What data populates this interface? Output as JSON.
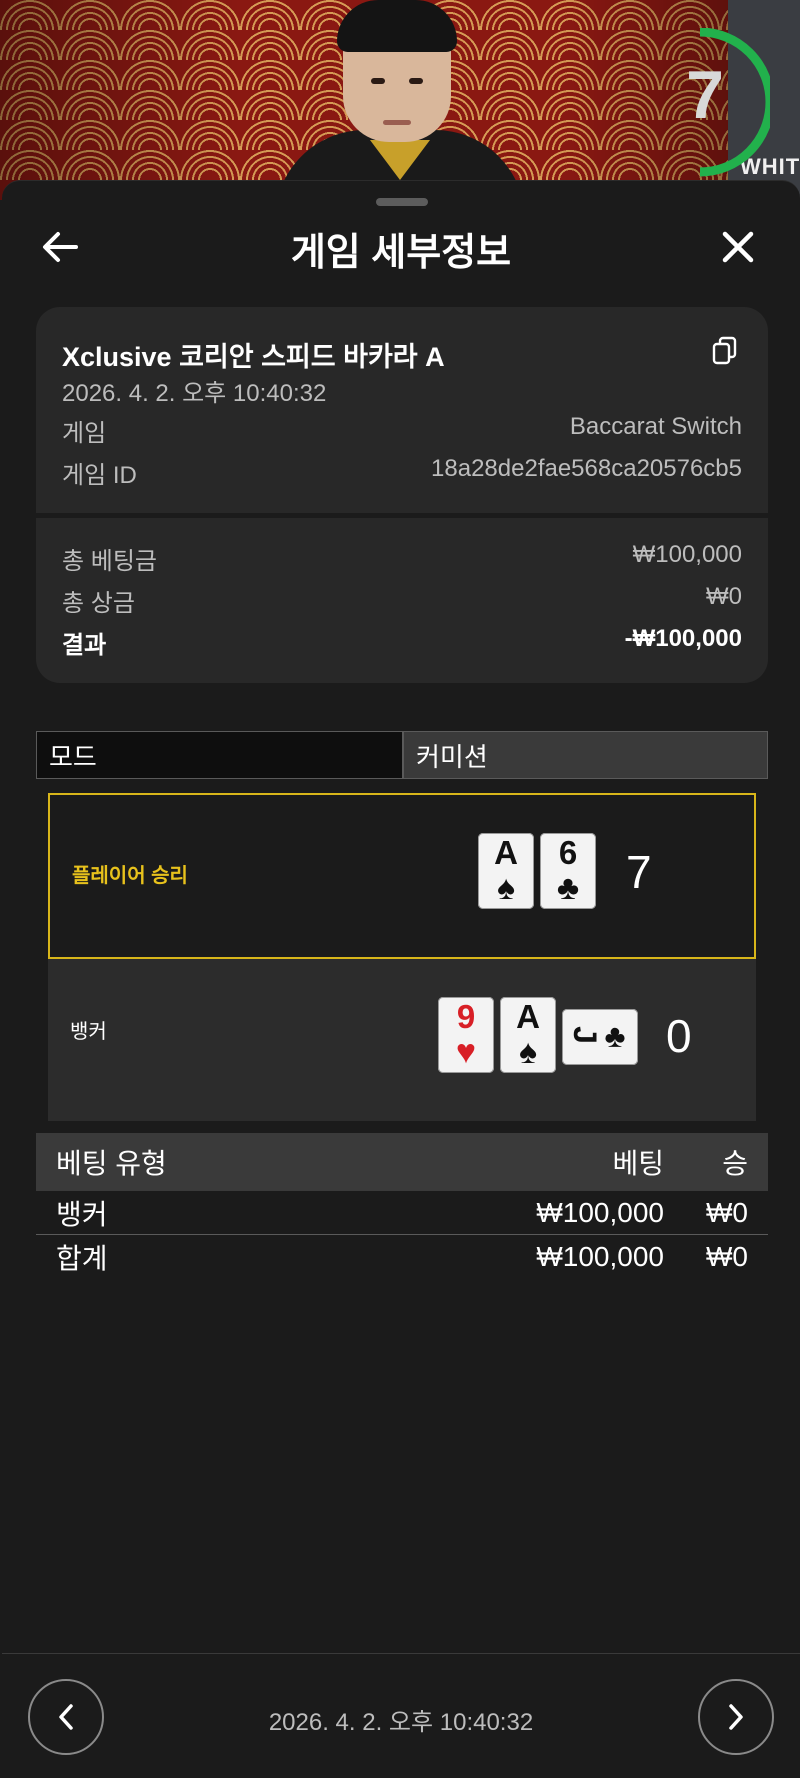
{
  "video": {
    "countdown": "7",
    "side_label": "WHITE"
  },
  "header": {
    "title": "게임 세부정보"
  },
  "summary": {
    "game_title": "Xclusive 코리안 스피드 바카라 A",
    "datetime": "2026. 4. 2. 오후 10:40:32",
    "game_label": "게임",
    "game_value": "Baccarat Switch",
    "game_id_label": "게임 ID",
    "game_id_value": "18a28de2fae568ca20576cb5",
    "total_bet_label": "총 베팅금",
    "total_bet_value": "₩100,000",
    "total_prize_label": "총 상금",
    "total_prize_value": "₩0",
    "result_label": "결과",
    "result_value": "-₩100,000"
  },
  "mode": {
    "key": "모드",
    "value": "커미션"
  },
  "round": {
    "player": {
      "label": "플레이어 승리",
      "label_color": "#e8c21c",
      "score": "7",
      "cards": [
        {
          "rank": "A",
          "suit": "♠",
          "color": "black"
        },
        {
          "rank": "6",
          "suit": "♣",
          "color": "black"
        }
      ]
    },
    "banker": {
      "label": "뱅커",
      "score": "0",
      "cards": [
        {
          "rank": "9",
          "suit": "♥",
          "color": "red"
        },
        {
          "rank": "A",
          "suit": "♠",
          "color": "black"
        },
        {
          "rank": "J",
          "suit": "♣",
          "color": "black",
          "sideways": true
        }
      ]
    }
  },
  "bets": {
    "headers": [
      "베팅 유형",
      "베팅",
      "승"
    ],
    "rows": [
      [
        "뱅커",
        "₩100,000",
        "₩0"
      ],
      [
        "합계",
        "₩100,000",
        "₩0"
      ]
    ]
  },
  "footer": {
    "datetime": "2026. 4. 2. 오후 10:40:32"
  },
  "icons": {
    "back": "arrow-left-icon",
    "close": "close-icon",
    "copy": "copy-icon",
    "prev": "chevron-left-icon",
    "next": "chevron-right-icon"
  }
}
